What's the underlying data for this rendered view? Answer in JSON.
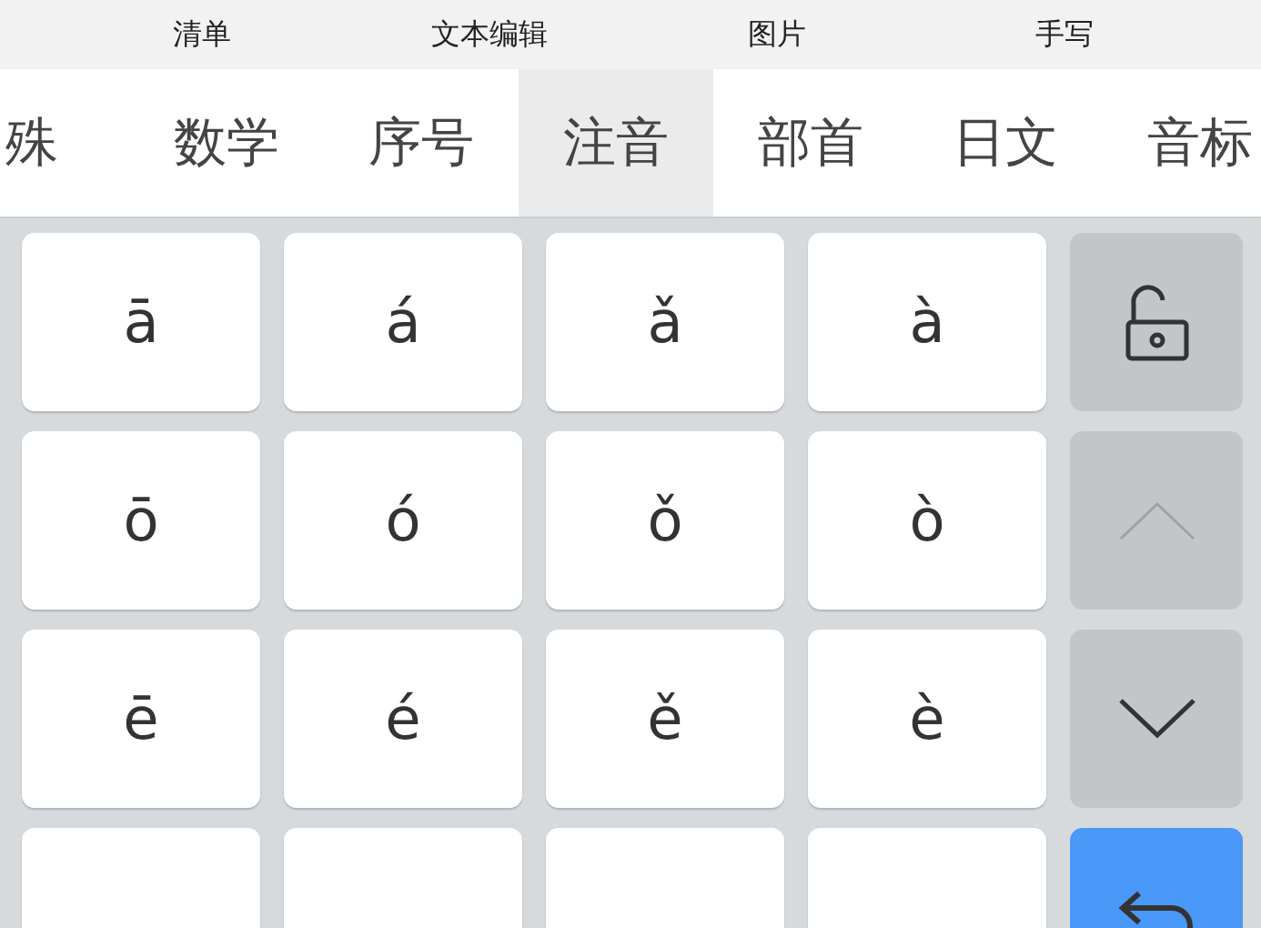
{
  "toolbar": [
    {
      "label": "清单"
    },
    {
      "label": "文本编辑"
    },
    {
      "label": "图片"
    },
    {
      "label": "手写"
    }
  ],
  "tabs": [
    {
      "label": "殊",
      "selected": false
    },
    {
      "label": "数学",
      "selected": false
    },
    {
      "label": "序号",
      "selected": false
    },
    {
      "label": "注音",
      "selected": true
    },
    {
      "label": "部首",
      "selected": false
    },
    {
      "label": "日文",
      "selected": false
    },
    {
      "label": "音标",
      "selected": false
    }
  ],
  "keys": [
    [
      {
        "kind": "letter",
        "label": "ā"
      },
      {
        "kind": "letter",
        "label": "á"
      },
      {
        "kind": "letter",
        "label": "ǎ"
      },
      {
        "kind": "letter",
        "label": "à"
      }
    ],
    [
      {
        "kind": "letter",
        "label": "ō"
      },
      {
        "kind": "letter",
        "label": "ó"
      },
      {
        "kind": "letter",
        "label": "ǒ"
      },
      {
        "kind": "letter",
        "label": "ò"
      }
    ],
    [
      {
        "kind": "letter",
        "label": "ē"
      },
      {
        "kind": "letter",
        "label": "é"
      },
      {
        "kind": "letter",
        "label": "ě"
      },
      {
        "kind": "letter",
        "label": "è"
      }
    ],
    [
      {
        "kind": "cut_off"
      },
      {
        "kind": "cut_off"
      },
      {
        "kind": "cut_off"
      },
      {
        "kind": "cut_off"
      }
    ]
  ],
  "side_keys": [
    {
      "kind": "lock",
      "disabled": false
    },
    {
      "kind": "up",
      "disabled": true
    },
    {
      "kind": "down",
      "disabled": false
    },
    {
      "kind": "enter",
      "disabled": false
    }
  ]
}
